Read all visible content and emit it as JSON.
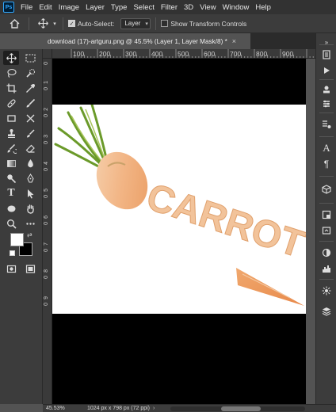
{
  "app": {
    "logo_text": "Ps"
  },
  "menu": [
    "File",
    "Edit",
    "Image",
    "Layer",
    "Type",
    "Select",
    "Filter",
    "3D",
    "View",
    "Window",
    "Help"
  ],
  "options": {
    "auto_select_label": "Auto-Select:",
    "auto_select_checked": true,
    "layer_dropdown": "Layer",
    "transform_controls_label": "Show Transform Controls",
    "transform_controls_checked": false
  },
  "document": {
    "tab_title": "download (17)-artguru.png @ 45.5% (Layer 1, Layer Mask/8) *",
    "close_glyph": "×",
    "image_text": "CARROT"
  },
  "ruler_top": [
    "100",
    "200",
    "300",
    "400",
    "500",
    "600",
    "700",
    "800",
    "900"
  ],
  "ruler_left": [
    "0",
    "1",
    "0",
    "2",
    "0",
    "3",
    "0",
    "4",
    "0",
    "5",
    "0",
    "6",
    "0",
    "7",
    "0",
    "8",
    "0",
    "9",
    "0"
  ],
  "tools": [
    {
      "name": "move-tool",
      "icon": "move-icon"
    },
    {
      "name": "marquee-tool",
      "icon": "marquee-icon"
    },
    {
      "name": "lasso-tool",
      "icon": "lasso-icon"
    },
    {
      "name": "quick-select-tool",
      "icon": "quick-select-icon"
    },
    {
      "name": "crop-tool",
      "icon": "crop-icon"
    },
    {
      "name": "eyedropper-tool",
      "icon": "eyedropper-icon"
    },
    {
      "name": "healing-tool",
      "icon": "healing-brush-icon"
    },
    {
      "name": "brush-tool",
      "icon": "brush-icon"
    },
    {
      "name": "frame-tool",
      "icon": "frame-icon"
    },
    {
      "name": "cross-tool",
      "icon": "cross-icon"
    },
    {
      "name": "stamp-tool",
      "icon": "clone-stamp-icon"
    },
    {
      "name": "history-brush-tool",
      "icon": "history-brush-icon"
    },
    {
      "name": "eraser-tool",
      "icon": "eraser-icon"
    },
    {
      "name": "gradient-tool",
      "icon": "gradient-icon"
    },
    {
      "name": "blur-tool",
      "icon": "blur-icon"
    },
    {
      "name": "dodge-tool",
      "icon": "dodge-icon"
    },
    {
      "name": "pen-tool",
      "icon": "pen-icon"
    },
    {
      "name": "type-tool",
      "icon": "type-icon",
      "glyph": "T"
    },
    {
      "name": "path-select-tool",
      "icon": "path-selection-icon"
    },
    {
      "name": "shape-tool",
      "icon": "ellipse-icon"
    },
    {
      "name": "hand-tool",
      "icon": "hand-icon"
    },
    {
      "name": "zoom-tool",
      "icon": "zoom-icon"
    },
    {
      "name": "more-tools",
      "icon": "more-icon"
    }
  ],
  "colors": {
    "foreground": "#ffffff",
    "background": "#000000",
    "accent": "#31a8ff"
  },
  "status": {
    "zoom": "45.53%",
    "dimensions": "1024 px x 798 px (72 ppi)",
    "arrow": "›"
  }
}
